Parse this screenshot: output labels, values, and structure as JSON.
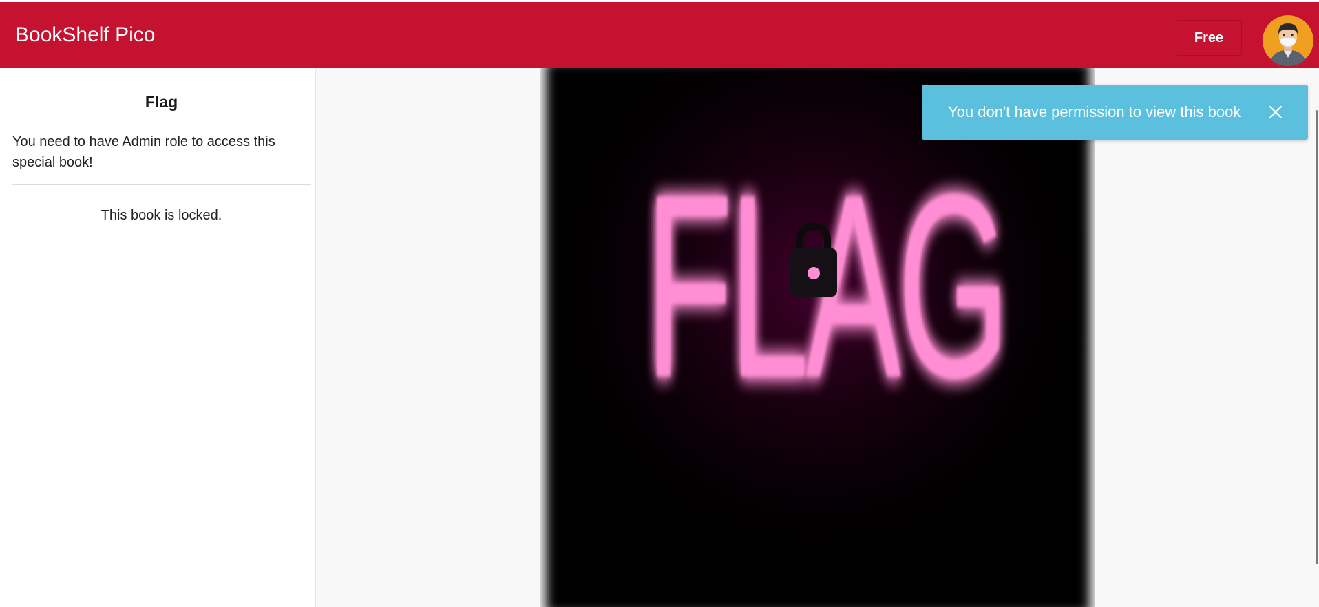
{
  "header": {
    "brand": "BookShelf Pico",
    "plan_button": "Free",
    "avatar_icon": "user-avatar-icon"
  },
  "book": {
    "title": "Flag",
    "description": "You need to have Admin role to access this special book!",
    "locked_message": "This book is locked.",
    "cover_text": "FLAG",
    "cover_icon": "lock-icon"
  },
  "toast": {
    "message": "You don't have permission to view this book",
    "close_icon": "close-icon"
  },
  "colors": {
    "header_bg": "#c41230",
    "toast_bg": "#5bc0de",
    "neon_pink": "#ff8ed4"
  }
}
